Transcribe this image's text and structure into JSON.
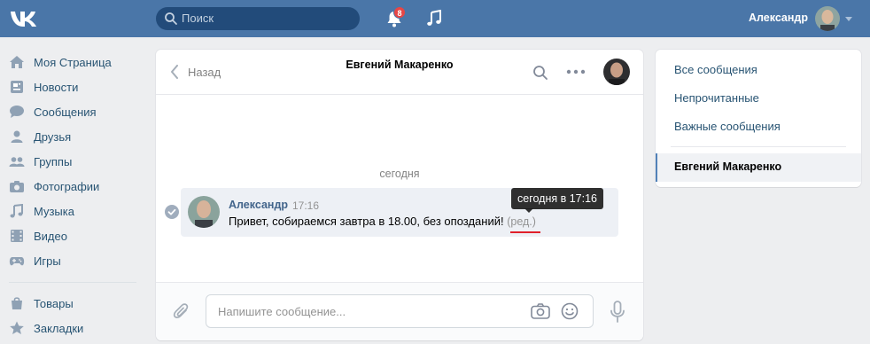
{
  "header": {
    "logo_icon": "vk-logo-icon",
    "search_placeholder": "Поиск",
    "notifications_count": "8",
    "user_name": "Александр",
    "accent_color": "#4a76a8",
    "badge_color": "#e64646"
  },
  "nav": {
    "items": [
      {
        "label": "Моя Страница",
        "icon": "home-icon"
      },
      {
        "label": "Новости",
        "icon": "news-icon"
      },
      {
        "label": "Сообщения",
        "icon": "messages-icon"
      },
      {
        "label": "Друзья",
        "icon": "friends-icon"
      },
      {
        "label": "Группы",
        "icon": "groups-icon"
      },
      {
        "label": "Фотографии",
        "icon": "camera-icon"
      },
      {
        "label": "Музыка",
        "icon": "music-icon"
      },
      {
        "label": "Видео",
        "icon": "video-icon"
      },
      {
        "label": "Игры",
        "icon": "gamepad-icon"
      },
      {
        "label": "Товары",
        "icon": "bag-icon"
      },
      {
        "label": "Закладки",
        "icon": "star-icon"
      }
    ]
  },
  "chat": {
    "back_label": "Назад",
    "title": "Евгений Макаренко",
    "date_separator": "сегодня",
    "message": {
      "author": "Александр",
      "time": "17:16",
      "text": "Привет, собираемся завтра в 18.00, без опозданий!",
      "edited_label": "(ред.)"
    },
    "tooltip": "сегодня в 17:16",
    "composer_placeholder": "Напишите сообщение..."
  },
  "right_panel": {
    "items": [
      "Все сообщения",
      "Непрочитанные",
      "Важные сообщения"
    ],
    "active_conversation": "Евгений Макаренко"
  }
}
